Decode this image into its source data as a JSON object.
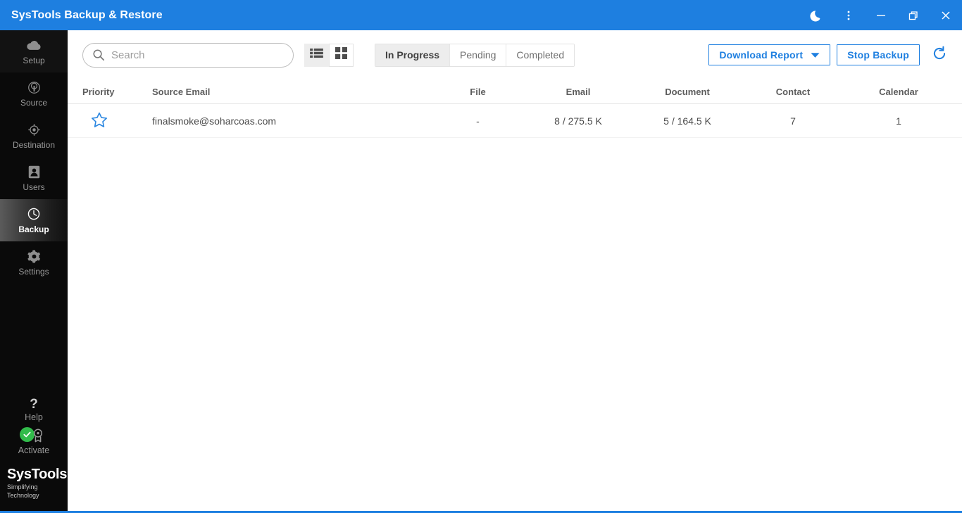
{
  "window": {
    "title": "SysTools Backup & Restore",
    "titlebar_color": "#1e7fe0",
    "controls": [
      {
        "name": "dark-mode-toggle",
        "icon": "moon-icon"
      },
      {
        "name": "more-options",
        "icon": "kebab-menu-icon"
      },
      {
        "name": "minimize",
        "icon": "minimize-icon"
      },
      {
        "name": "restore",
        "icon": "restore-icon"
      },
      {
        "name": "close",
        "icon": "close-icon"
      }
    ]
  },
  "sidebar": {
    "items": [
      {
        "label": "Setup",
        "icon": "cloud-icon",
        "active": false
      },
      {
        "label": "Source",
        "icon": "source-icon",
        "active": false
      },
      {
        "label": "Destination",
        "icon": "target-icon",
        "active": false
      },
      {
        "label": "Users",
        "icon": "user-card-icon",
        "active": false
      },
      {
        "label": "Backup",
        "icon": "clock-icon",
        "active": true
      },
      {
        "label": "Settings",
        "icon": "gear-icon",
        "active": false
      }
    ],
    "help": {
      "label": "Help",
      "icon": "question-mark-icon"
    },
    "activate": {
      "label": "Activate",
      "icon": "badge-icon",
      "status_icon": "green-check-icon",
      "status_color": "#32bb4b"
    },
    "brand": {
      "name": "SysTools",
      "registered": "®",
      "tagline": "Simplifying Technology"
    }
  },
  "toolbar": {
    "search": {
      "placeholder": "Search",
      "value": "",
      "icon": "search-icon"
    },
    "views": [
      {
        "name": "list-view",
        "icon": "list-icon",
        "selected": true
      },
      {
        "name": "grid-view",
        "icon": "grid-icon",
        "selected": false
      }
    ],
    "status_tabs": [
      {
        "label": "In Progress",
        "selected": true
      },
      {
        "label": "Pending",
        "selected": false
      },
      {
        "label": "Completed",
        "selected": false
      }
    ],
    "download_report_label": "Download Report",
    "download_report_icon": "chevron-down-icon",
    "stop_backup_label": "Stop Backup",
    "refresh_icon": "refresh-icon",
    "accent_color": "#1e7fe0"
  },
  "table": {
    "columns": [
      "Priority",
      "Source Email",
      "File",
      "Email",
      "Document",
      "Contact",
      "Calendar"
    ],
    "rows": [
      {
        "priority_icon": "star-outline-icon",
        "source_email": "finalsmoke@soharcoas.com",
        "file": "-",
        "email": "8 / 275.5 K",
        "document": "5 / 164.5 K",
        "contact": "7",
        "calendar": "1"
      }
    ]
  }
}
